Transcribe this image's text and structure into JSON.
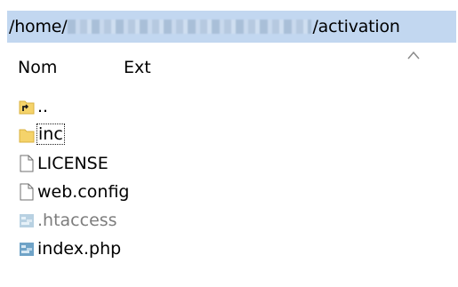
{
  "path": {
    "prefix": "/home/",
    "suffix": "/activation"
  },
  "header": {
    "name_col": "Nom",
    "ext_col": "Ext"
  },
  "files": [
    {
      "label": "..",
      "icon": "parent-folder-icon",
      "style": "normal"
    },
    {
      "label": "inc",
      "icon": "folder-icon",
      "style": "focused"
    },
    {
      "label": "LICENSE",
      "icon": "file-icon",
      "style": "normal"
    },
    {
      "label": "web.config",
      "icon": "file-icon",
      "style": "normal"
    },
    {
      "label": ".htaccess",
      "icon": "script-icon",
      "style": "dim"
    },
    {
      "label": "index.php",
      "icon": "script-icon",
      "style": "normal"
    }
  ],
  "colors": {
    "pathbar_bg": "#c2d7f0",
    "folder_yellow": "#f5d36a",
    "dim_text": "#7d7d7d"
  }
}
